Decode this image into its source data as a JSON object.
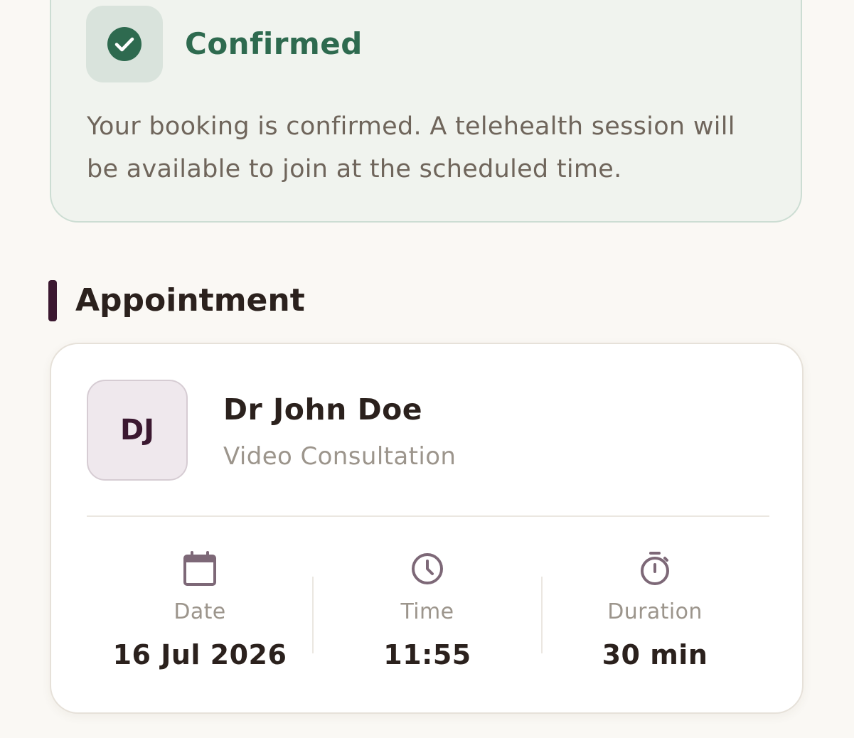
{
  "status": {
    "title": "Confirmed",
    "message": "Your booking is confirmed. A telehealth session will be available to join at the scheduled time.",
    "icon": "check-circle-icon",
    "accent_color": "#2e6a4f"
  },
  "section": {
    "title": "Appointment",
    "accent_color": "#3b1830"
  },
  "appointment": {
    "doctor_initials": "DJ",
    "doctor_name": "Dr John Doe",
    "consultation_type": "Video Consultation",
    "details": [
      {
        "icon": "calendar-icon",
        "label": "Date",
        "value": "16 Jul 2026"
      },
      {
        "icon": "clock-icon",
        "label": "Time",
        "value": "11:55"
      },
      {
        "icon": "stopwatch-icon",
        "label": "Duration",
        "value": "30 min"
      }
    ]
  }
}
